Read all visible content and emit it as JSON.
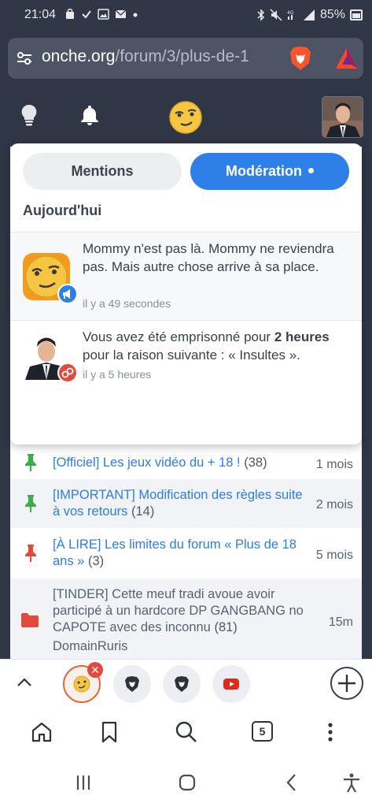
{
  "status_bar": {
    "time": "21:04",
    "battery": "85%"
  },
  "url_bar": {
    "domain": "onche.org",
    "path": "/forum/3/plus-de-1"
  },
  "popup": {
    "tabs": [
      {
        "label": "Mentions",
        "active": false
      },
      {
        "label": "Modération",
        "active": true
      }
    ],
    "section_title": "Aujourd'hui",
    "notifications": [
      {
        "text": "Mommy n'est pas là. Mommy ne reviendra pas. Mais autre chose arrive à sa place.",
        "time": "il y a 49 secondes",
        "badge_icon": "megaphone-icon"
      },
      {
        "text_before": "Vous avez été emprisonné pour ",
        "text_bold": "2 heures",
        "text_after": " pour la raison suivante : « Insultes ».",
        "time": "il y a 5 heures",
        "badge_icon": "handcuffs-icon"
      }
    ]
  },
  "topics": [
    {
      "title": "[Officiel] Les jeux vidéo du + 18 !",
      "count": "(38)",
      "age": "1 mois",
      "pin": "green"
    },
    {
      "title": "[IMPORTANT] Modification des règles suite à vos retours",
      "count": "(14)",
      "age": "2 mois",
      "pin": "green"
    },
    {
      "title": "[À LIRE] Les limites du forum « Plus de 18 ans »",
      "count": "(3)",
      "age": "5 mois",
      "pin": "red"
    },
    {
      "title": "[TINDER] Cette meuf tradi avoue avoir participé à un hardcore DP GANGBANG no CAPOTE avec des inconnu",
      "count": "(81)",
      "author": "DomainRuris",
      "age": "15m"
    }
  ],
  "browser": {
    "tab_count": "5"
  },
  "colors": {
    "header_bg": "#2f3747",
    "accent": "#2f7fe8",
    "link": "#2b7de9",
    "pin_green": "#3aae48",
    "pin_red": "#e24b3b"
  }
}
